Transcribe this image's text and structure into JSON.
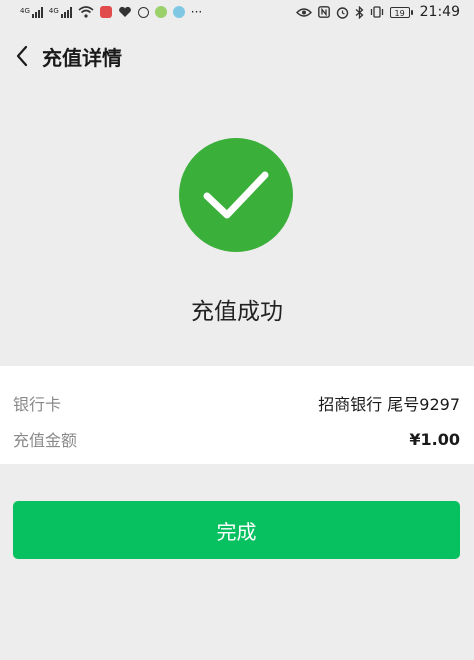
{
  "status_bar": {
    "signal_1_label": "4G",
    "signal_2_label": "4G",
    "battery": "19",
    "time": "21:49",
    "more": "···",
    "icons_left": [
      "signal-icon",
      "signal-icon",
      "wifi-icon",
      "mic-icon",
      "heart-icon",
      "app-icon",
      "app-icon",
      "app-icon"
    ],
    "icons_right": [
      "eye-icon",
      "nfc-icon",
      "alarm-icon",
      "bluetooth-icon",
      "vibrate-icon",
      "battery-icon"
    ]
  },
  "nav": {
    "title": "充值详情"
  },
  "result": {
    "text": "充值成功",
    "color": "#3aaf3a"
  },
  "details": [
    {
      "label": "银行卡",
      "value": "招商银行 尾号9297"
    },
    {
      "label": "充值金额",
      "value": "¥1.00"
    }
  ],
  "actions": {
    "done_label": "完成",
    "done_color": "#07c160"
  }
}
